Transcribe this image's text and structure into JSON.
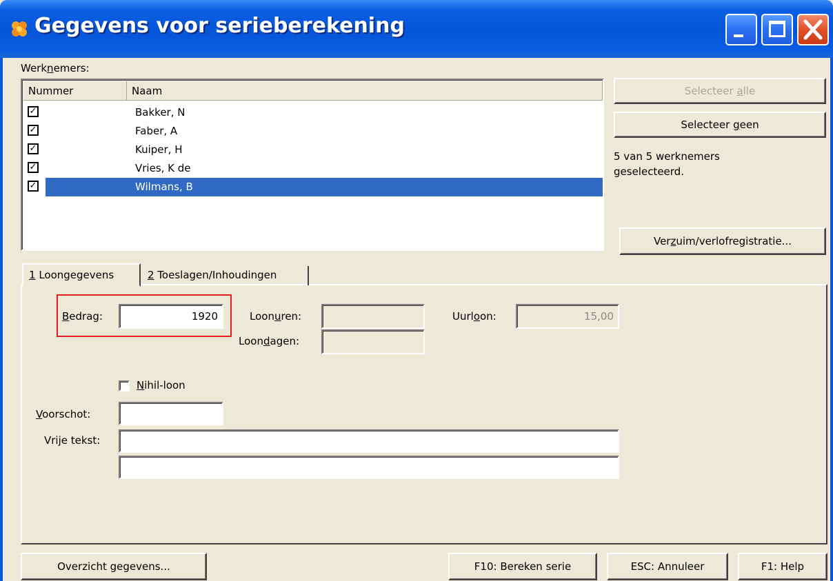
{
  "window": {
    "title": "Gegevens voor serieberekening",
    "icon": "app-flower-icon",
    "controls": [
      "minimize",
      "maximize",
      "close"
    ],
    "accent_color": "#0a5fe2"
  },
  "employees": {
    "label_pre": "Werk",
    "label_key": "n",
    "label_post": "emers:",
    "columns": [
      "Nummer",
      "Naam"
    ],
    "rows": [
      {
        "checked": true,
        "name": "Bakker, N",
        "selected": false
      },
      {
        "checked": true,
        "name": "Faber, A",
        "selected": false
      },
      {
        "checked": true,
        "name": "Kuiper, H",
        "selected": false
      },
      {
        "checked": true,
        "name": "Vries, K de",
        "selected": false
      },
      {
        "checked": true,
        "name": "Wilmans, B",
        "selected": true
      }
    ],
    "status_line1": "5 van 5 werknemers",
    "status_line2": "geselecteerd.",
    "select_all": {
      "pre": "Selecteer ",
      "key": "a",
      "post": "lle",
      "enabled": false
    },
    "select_none": {
      "pre": "Selecteer ",
      "key": "g",
      "post": "een",
      "enabled": true
    },
    "absence_button": {
      "pre": "Ver",
      "key": "z",
      "post": "uim/verlofregistratie..."
    }
  },
  "tabs": [
    {
      "key": "1",
      "label": " Loongegevens",
      "active": true
    },
    {
      "key": "2",
      "label": " Toeslagen/Inhoudingen",
      "active": false
    }
  ],
  "form": {
    "bedrag": {
      "key": "B",
      "rest": "edrag:",
      "value": "1920"
    },
    "loonuren": {
      "pre": "Loon",
      "key": "u",
      "post": "ren:",
      "value": ""
    },
    "loondagen": {
      "pre": "Loon",
      "key": "d",
      "post": "agen:",
      "value": ""
    },
    "uurloon": {
      "pre": "Uurl",
      "key": "o",
      "post": "on:",
      "value": "15,00"
    },
    "nihil": {
      "key": "N",
      "rest": "ihil-loon",
      "checked": false
    },
    "voorschot": {
      "key": "V",
      "rest": "oorschot:",
      "value": ""
    },
    "vrije_tekst": {
      "label": "Vrije tekst:",
      "line1": "",
      "line2": ""
    }
  },
  "footer": {
    "overview": "Overzicht gegevens...",
    "calculate": "F10: Bereken serie",
    "cancel": "ESC: Annuleer",
    "help": "F1: Help"
  }
}
